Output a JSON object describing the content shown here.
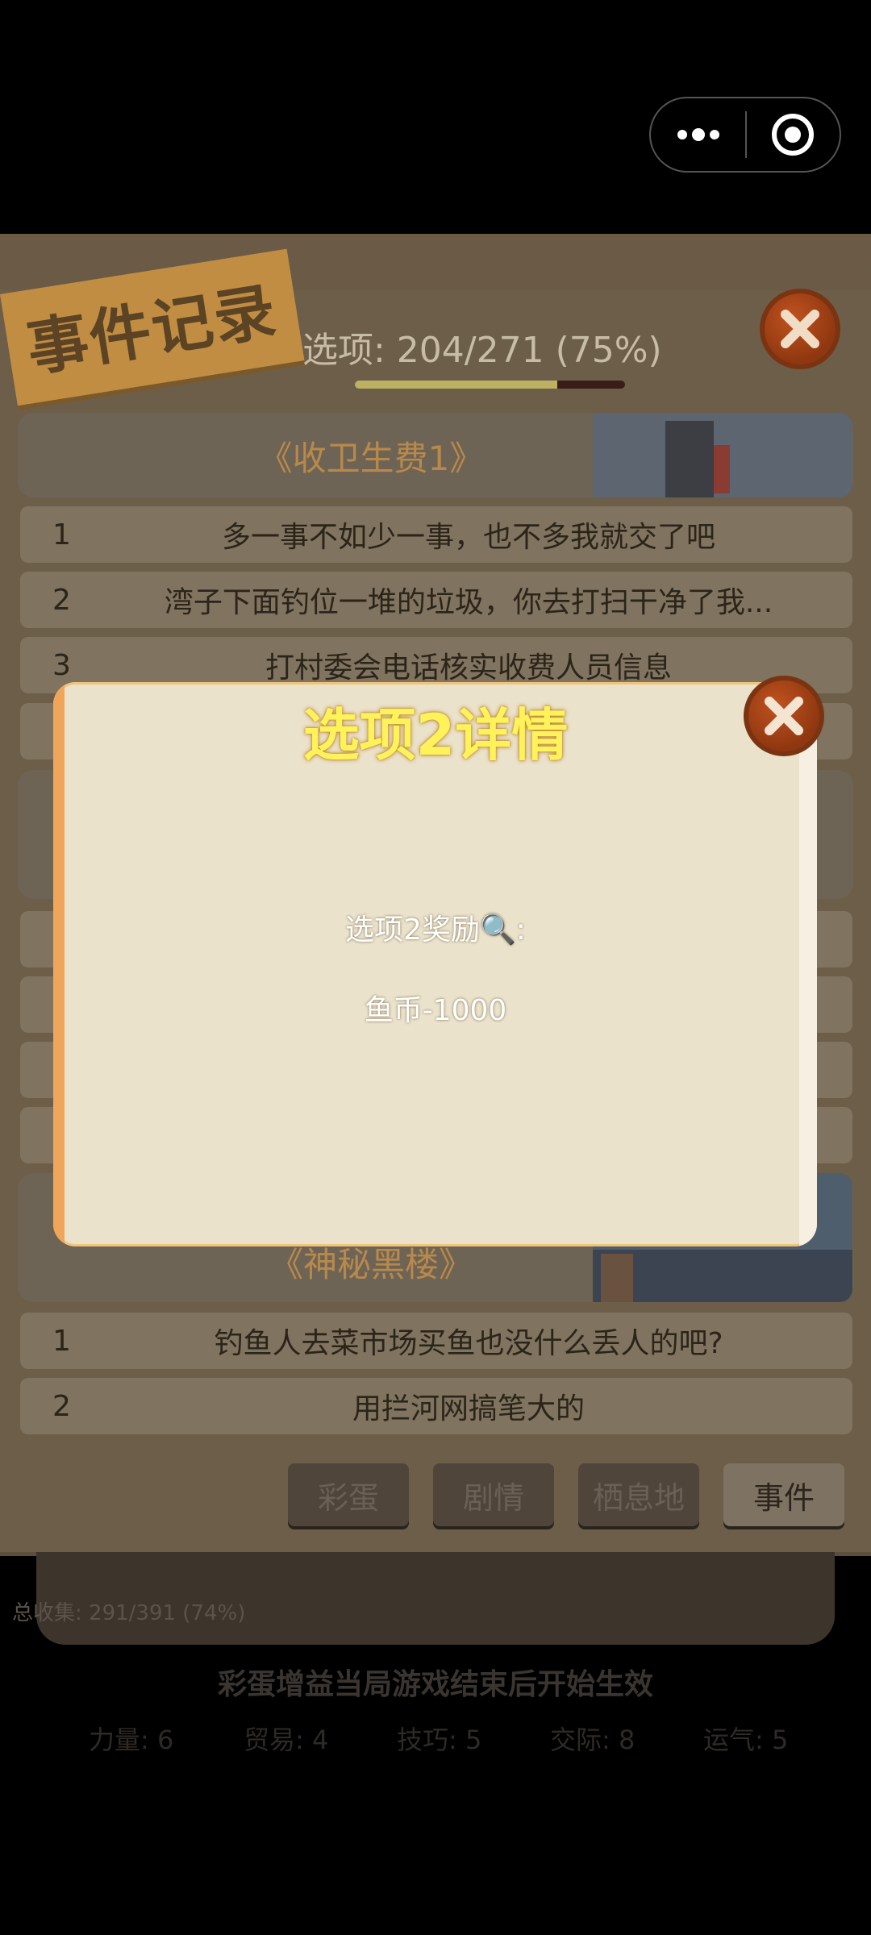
{
  "header": {
    "title": "事件记录",
    "progress_text": "选项: 204/271 (75%)",
    "progress": 0.75
  },
  "events": [
    {
      "title": "《收卫生费1》",
      "options": [
        {
          "num": "1",
          "text": "多一事不如少一事，也不多我就交了吧"
        },
        {
          "num": "2",
          "text": "湾子下面钓位一堆的垃圾，你去打扫干净了我..."
        },
        {
          "num": "3",
          "text": "打村委会电话核实收费人员信息"
        }
      ]
    },
    {
      "title": "《神秘黑楼》",
      "options": [
        {
          "num": "1",
          "text": "钓鱼人去菜市场买鱼也没什么丢人的吧?"
        },
        {
          "num": "2",
          "text": "用拦河网搞笔大的"
        }
      ]
    }
  ],
  "tabs": [
    "彩蛋",
    "剧情",
    "栖息地",
    "事件"
  ],
  "active_tab": "事件",
  "total_collect": "总收集: 291/391 (74%)",
  "footer_note": "彩蛋增益当局游戏结束后开始生效",
  "stats": [
    "力量: 6",
    "贸易: 4",
    "技巧: 5",
    "交际: 8",
    "运气: 5"
  ],
  "modal": {
    "title": "选项2详情",
    "reward_label": "选项2奖励🔍:",
    "reward_value": "鱼币-1000"
  },
  "colors": {
    "close_button": "#a8451a",
    "modal_bg": "#ebe2cc",
    "modal_title": "#fff25a"
  }
}
